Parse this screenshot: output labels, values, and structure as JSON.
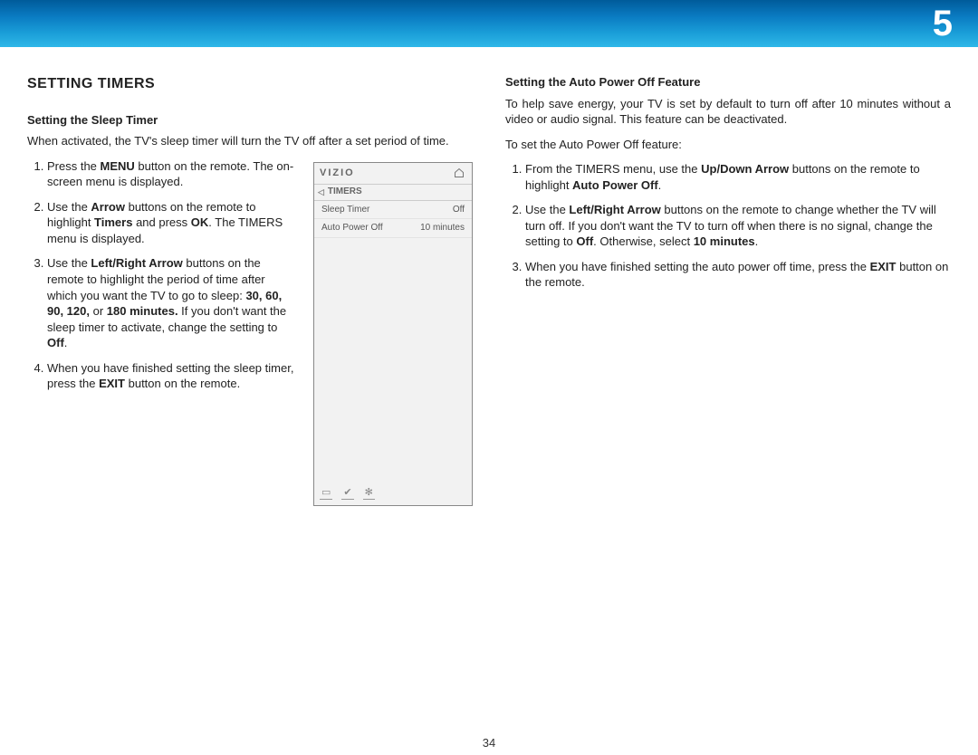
{
  "chapter": "5",
  "page_number": "34",
  "heading_main": "SETTING TIMERS",
  "left": {
    "subheading": "Setting the Sleep Timer",
    "intro": "When activated, the TV's sleep timer will turn the TV off after a set period of time.",
    "steps_html": [
      "Press the <b>MENU</b> button on the remote. The on-screen menu is displayed.",
      "Use the <b>Arrow</b> buttons on the remote to highlight <b>Timers</b> and press <b>OK</b>. The TIMERS menu is displayed.",
      "Use the <b>Left/Right Arrow</b> buttons on the remote to highlight the period of time after which you want the TV to go to sleep: <b>30, 60, 90, 120,</b> or <b>180 minutes.</b> If you don't want the sleep timer to activate, change the setting to <b>Off</b>.",
      "When you have finished setting the sleep timer, press the <b>EXIT</b> button on the remote."
    ]
  },
  "right": {
    "subheading": "Setting the Auto Power Off Feature",
    "intro": "To help save energy, your TV is set by default to turn off after 10 minutes without a video or audio signal. This feature can be deactivated.",
    "lead": "To set the Auto Power Off feature:",
    "steps_html": [
      "From the TIMERS menu, use the <b>Up/Down Arrow</b> buttons on the remote to highlight <b>Auto Power Off</b>.",
      "Use the <b>Left/Right Arrow</b> buttons on the remote to change whether the TV will turn off. If you don't want the TV to turn off when there is no signal, change the setting to <b>Off</b>. Otherwise, select <b>10 minutes</b>.",
      "When you have finished setting the auto power off time, press the <b>EXIT</b> button on the remote."
    ]
  },
  "osd": {
    "logo": "VIZIO",
    "breadcrumb": "TIMERS",
    "rows": [
      {
        "label": "Sleep Timer",
        "value": "Off"
      },
      {
        "label": "Auto Power Off",
        "value": "10 minutes"
      }
    ]
  }
}
